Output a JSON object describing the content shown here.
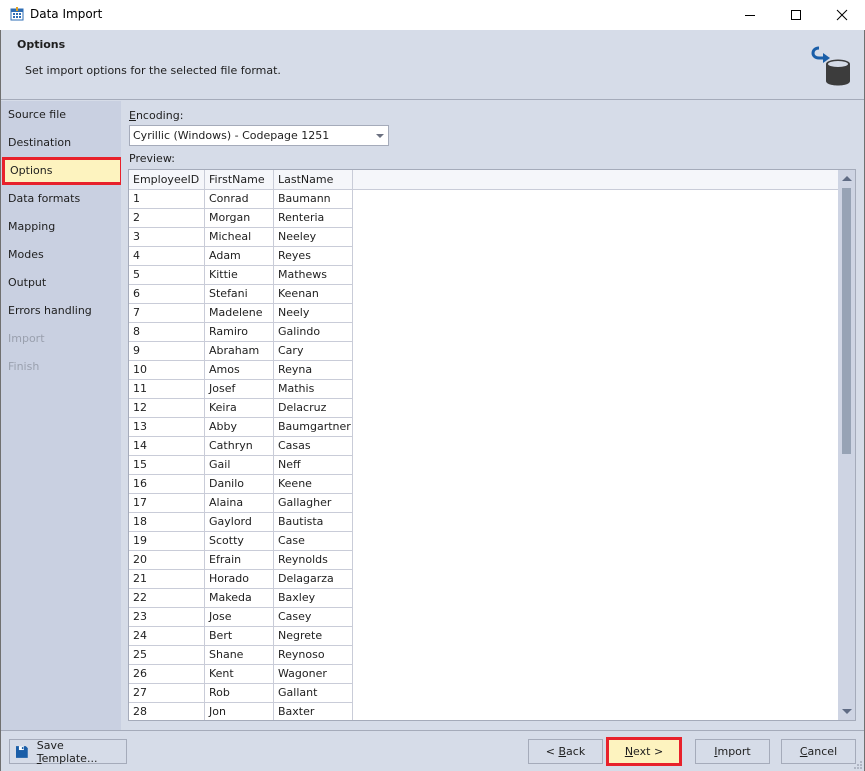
{
  "window": {
    "title": "Data Import",
    "icon": "calendar-grid-icon",
    "controls": [
      "minimize-icon",
      "maximize-icon",
      "close-icon"
    ]
  },
  "header": {
    "title": "Options",
    "description": "Set import options for the selected file format.",
    "icon": "import-to-database-icon"
  },
  "sidebar": {
    "items": [
      {
        "label": "Source file",
        "state": "normal"
      },
      {
        "label": "Destination",
        "state": "normal"
      },
      {
        "label": "Options",
        "state": "active"
      },
      {
        "label": "Data formats",
        "state": "normal"
      },
      {
        "label": "Mapping",
        "state": "normal"
      },
      {
        "label": "Modes",
        "state": "normal"
      },
      {
        "label": "Output",
        "state": "normal"
      },
      {
        "label": "Errors handling",
        "state": "normal"
      },
      {
        "label": "Import",
        "state": "disabled"
      },
      {
        "label": "Finish",
        "state": "disabled"
      }
    ]
  },
  "encoding": {
    "label_accel": "E",
    "label_rest": "ncoding:",
    "value": "Cyrillic (Windows) - Codepage 1251"
  },
  "preview": {
    "label": "Preview:",
    "columns": [
      "EmployeeID",
      "FirstName",
      "LastName"
    ],
    "rows": [
      [
        "1",
        "Conrad",
        "Baumann"
      ],
      [
        "2",
        "Morgan",
        "Renteria"
      ],
      [
        "3",
        "Micheal",
        "Neeley"
      ],
      [
        "4",
        "Adam",
        "Reyes"
      ],
      [
        "5",
        "Kittie",
        "Mathews"
      ],
      [
        "6",
        "Stefani",
        "Keenan"
      ],
      [
        "7",
        "Madelene",
        "Neely"
      ],
      [
        "8",
        "Ramiro",
        "Galindo"
      ],
      [
        "9",
        "Abraham",
        "Cary"
      ],
      [
        "10",
        "Amos",
        "Reyna"
      ],
      [
        "11",
        "Josef",
        "Mathis"
      ],
      [
        "12",
        "Keira",
        "Delacruz"
      ],
      [
        "13",
        "Abby",
        "Baumgartner"
      ],
      [
        "14",
        "Cathryn",
        "Casas"
      ],
      [
        "15",
        "Gail",
        "Neff"
      ],
      [
        "16",
        "Danilo",
        "Keene"
      ],
      [
        "17",
        "Alaina",
        "Gallagher"
      ],
      [
        "18",
        "Gaylord",
        "Bautista"
      ],
      [
        "19",
        "Scotty",
        "Case"
      ],
      [
        "20",
        "Efrain",
        "Reynolds"
      ],
      [
        "21",
        "Horado",
        "Delagarza"
      ],
      [
        "22",
        "Makeda",
        "Baxley"
      ],
      [
        "23",
        "Jose",
        "Casey"
      ],
      [
        "24",
        "Bert",
        "Negrete"
      ],
      [
        "25",
        "Shane",
        "Reynoso"
      ],
      [
        "26",
        "Kent",
        "Wagoner"
      ],
      [
        "27",
        "Rob",
        "Gallant"
      ],
      [
        "28",
        "Jon",
        "Baxter"
      ]
    ],
    "scroll_position_fraction": 0
  },
  "footer": {
    "save_template": {
      "pre": "Save ",
      "accel": "T",
      "post": "emplate..."
    },
    "back": {
      "pre": "< ",
      "accel": "B",
      "post": "ack"
    },
    "next": {
      "pre": "",
      "accel": "N",
      "post": "ext >"
    },
    "import": {
      "pre": "",
      "accel": "I",
      "post": "mport"
    },
    "cancel": {
      "pre": "",
      "accel": "C",
      "post": "ancel"
    }
  },
  "colors": {
    "highlight_border": "#e8212b",
    "highlight_fill": "#fdf3bf",
    "panel_bg": "#d6dce8",
    "sidebar_bg": "#c9d0e1",
    "icon_blue": "#1a5ea8",
    "icon_dark": "#3c3c3c"
  }
}
